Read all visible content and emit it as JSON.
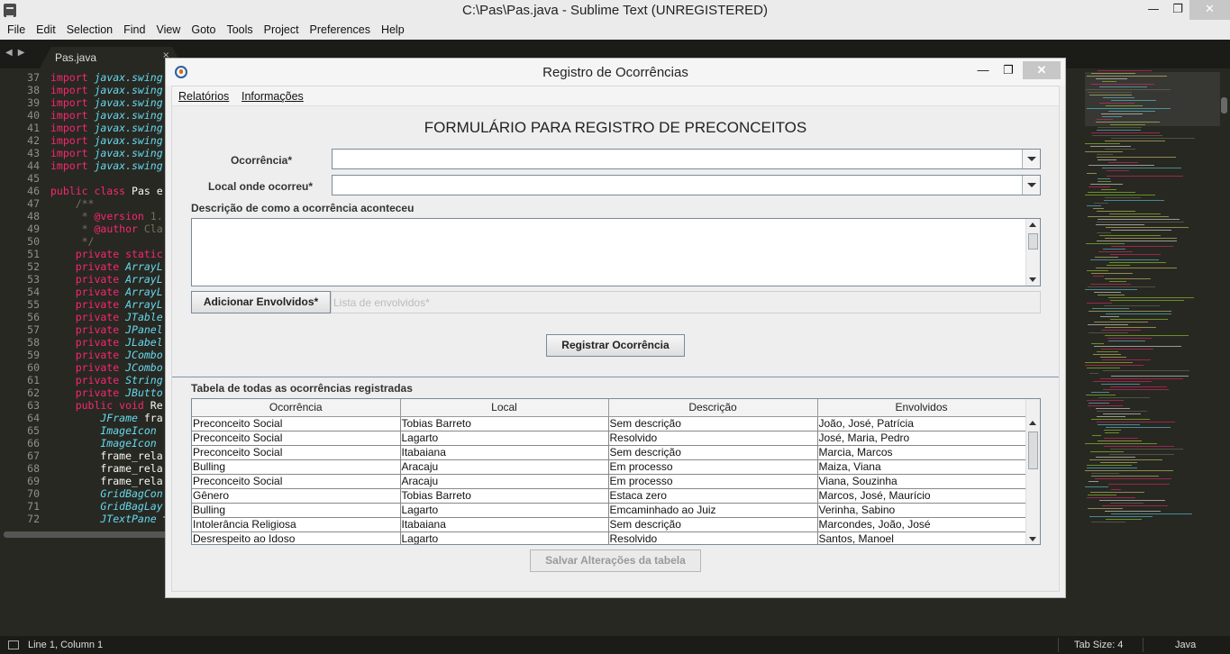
{
  "window": {
    "title": "C:\\Pas\\Pas.java - Sublime Text (UNREGISTERED)",
    "minimize": "—",
    "maximize": "❐",
    "close": "✕"
  },
  "menu": [
    "File",
    "Edit",
    "Selection",
    "Find",
    "View",
    "Goto",
    "Tools",
    "Project",
    "Preferences",
    "Help"
  ],
  "tab": {
    "label": "Pas.java",
    "close": "×",
    "nav": "◀▶"
  },
  "gutter": [
    37,
    38,
    39,
    40,
    41,
    42,
    43,
    44,
    45,
    46,
    47,
    48,
    49,
    50,
    51,
    52,
    53,
    54,
    55,
    56,
    57,
    58,
    59,
    60,
    61,
    62,
    63,
    64,
    65,
    66,
    67,
    68,
    69,
    70,
    71,
    72
  ],
  "code": [
    [
      "kw:import ",
      "ty:javax.swing"
    ],
    [
      "kw:import ",
      "ty:javax.swing"
    ],
    [
      "kw:import ",
      "ty:javax.swing"
    ],
    [
      "kw:import ",
      "ty:javax.swing"
    ],
    [
      "kw:import ",
      "ty:javax.swing"
    ],
    [
      "kw:import ",
      "ty:javax.swing"
    ],
    [
      "kw:import ",
      "ty:javax.swing"
    ],
    [
      "kw:import ",
      "ty:javax.swing"
    ],
    [],
    [
      "kw:public class ",
      "tx:Pas e"
    ],
    [
      "cm:    /**"
    ],
    [
      "cm:     * ",
      "at:@version ",
      "cm:1."
    ],
    [
      "cm:     * ",
      "at:@author ",
      "cm:Cla"
    ],
    [
      "cm:     */"
    ],
    [
      "kw:    private static"
    ],
    [
      "kw:    private ",
      "ty:ArrayL"
    ],
    [
      "kw:    private ",
      "ty:ArrayL"
    ],
    [
      "kw:    private ",
      "ty:ArrayL"
    ],
    [
      "kw:    private ",
      "ty:ArrayL"
    ],
    [
      "kw:    private ",
      "ty:JTable"
    ],
    [
      "kw:    private ",
      "ty:JPanel"
    ],
    [
      "kw:    private ",
      "ty:JLabel"
    ],
    [
      "kw:    private ",
      "ty:JCombo"
    ],
    [
      "kw:    private ",
      "ty:JCombo"
    ],
    [
      "kw:    private ",
      "ty:String"
    ],
    [
      "kw:    private ",
      "ty:JButto"
    ],
    [
      "kw:    public void ",
      "tx:Re"
    ],
    [
      "ty:        JFrame ",
      "tx:fra"
    ],
    [
      "ty:        ImageIcon"
    ],
    [
      "ty:        ImageIcon"
    ],
    [
      "tx:        frame_rela"
    ],
    [
      "tx:        frame_rela"
    ],
    [
      "tx:        frame_rela"
    ],
    [
      "ty:        GridBagCon"
    ],
    [
      "ty:        GridBagLay"
    ],
    [
      "ty:        JTextPane ",
      "tx:t"
    ]
  ],
  "status": {
    "position": "Line 1, Column 1",
    "tab_size": "Tab Size: 4",
    "syntax": "Java"
  },
  "dialog": {
    "title": "Registro de Ocorrências",
    "menu": [
      "Relatórios",
      "Informações"
    ],
    "form_title": "FORMULÁRIO PARA REGISTRO DE PRECONCEITOS",
    "label_ocorrencia": "Ocorrência*",
    "label_local": "Local onde ocorreu*",
    "label_descricao": "Descrição de como a ocorrência aconteceu",
    "add_button": "Adicionar Envolvidos*",
    "envolvidos_placeholder": "Lista de envolvidos*",
    "register_button": "Registrar Ocorrência",
    "table_title": "Tabela de todas as ocorrências registradas",
    "save_button": "Salvar Alterações da tabela",
    "table": {
      "columns": [
        "Ocorrência",
        "Local",
        "Descrição",
        "Envolvidos"
      ],
      "rows": [
        [
          "Preconceito Social",
          "Tobias Barreto",
          "Sem descrição",
          "João, José, Patrícia"
        ],
        [
          "Preconceito Social",
          "Lagarto",
          "Resolvido",
          "José, Maria, Pedro"
        ],
        [
          "Preconceito Social",
          "Itabaiana",
          "Sem descrição",
          "Marcia, Marcos"
        ],
        [
          "Bulling",
          "Aracaju",
          "Em processo",
          "Maiza, Viana"
        ],
        [
          "Preconceito Social",
          "Aracaju",
          "Em processo",
          "Viana, Souzinha"
        ],
        [
          "Gênero",
          "Tobias Barreto",
          "Estaca zero",
          "Marcos, José, Maurício"
        ],
        [
          "Bulling",
          "Lagarto",
          "Emcaminhado ao Juiz",
          "Verinha, Sabino"
        ],
        [
          "Intolerância Religiosa",
          "Itabaiana",
          "Sem descrição",
          "Marcondes, João, José"
        ],
        [
          "Desrespeito ao Idoso",
          "Lagarto",
          "Resolvido",
          "Santos, Manoel"
        ]
      ]
    }
  }
}
